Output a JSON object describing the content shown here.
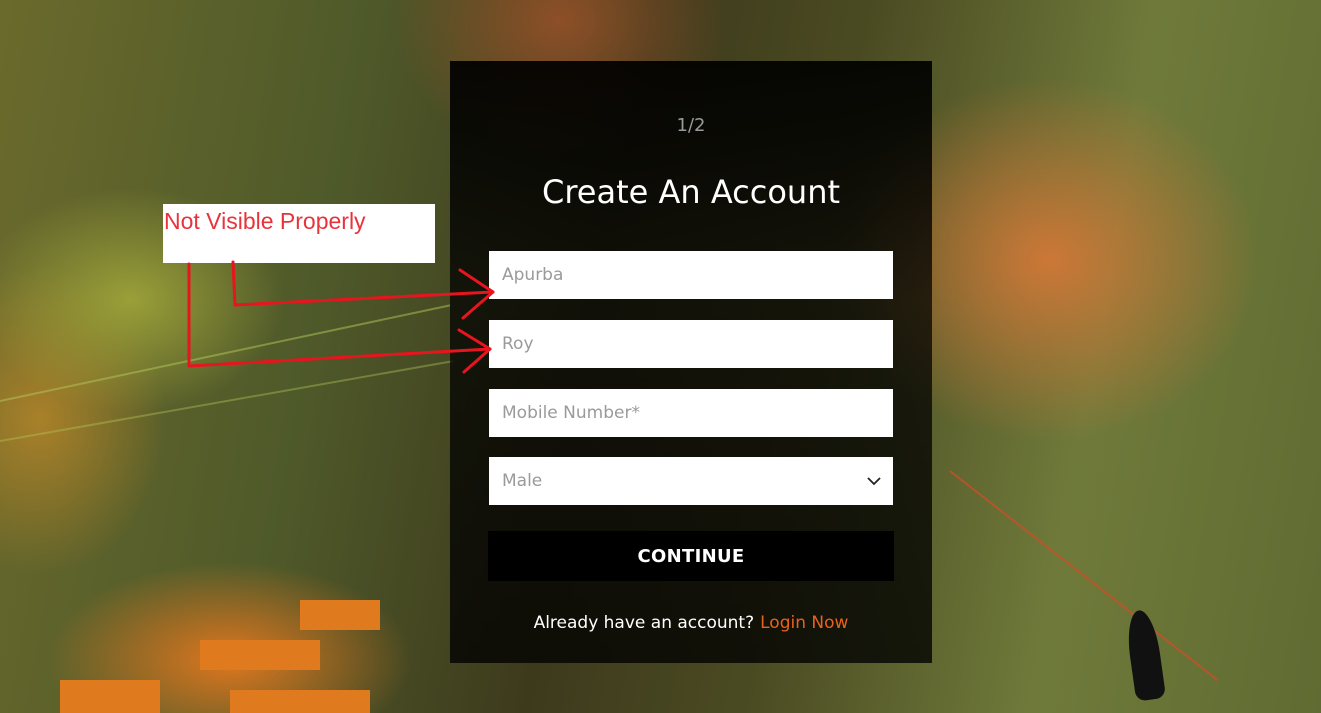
{
  "form": {
    "step": "1/2",
    "title": "Create An Account",
    "first_name_placeholder": "Apurba",
    "last_name_placeholder": "Roy",
    "mobile_placeholder": "Mobile Number*",
    "gender_selected": "Male",
    "continue_label": "CONTINUE",
    "login_prompt": "Already have an account?",
    "login_link": "Login Now"
  },
  "annotation": {
    "text": "Not Visible Properly",
    "color": "#e8333c"
  },
  "colors": {
    "accent": "#e8621c",
    "button_bg": "#000000",
    "arrow": "#e8141e"
  },
  "icons": {
    "select_chevron": "chevron-down-icon"
  }
}
